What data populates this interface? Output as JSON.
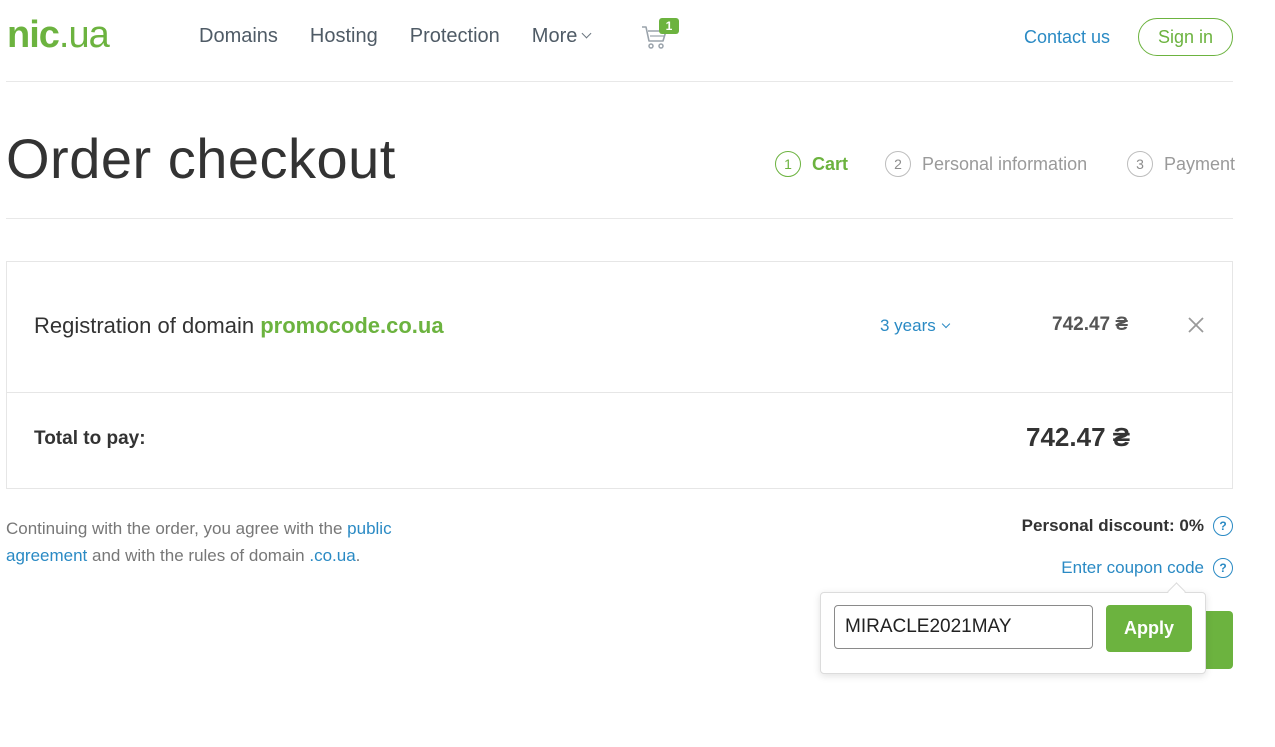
{
  "header": {
    "logo": {
      "part1": "nic",
      "part2": ".ua"
    },
    "nav": [
      "Domains",
      "Hosting",
      "Protection",
      "More"
    ],
    "cart_count": "1",
    "contact_label": "Contact us",
    "signin_label": "Sign in"
  },
  "page": {
    "title": "Order checkout",
    "steps": [
      {
        "num": "1",
        "label": "Cart",
        "active": true
      },
      {
        "num": "2",
        "label": "Personal information",
        "active": false
      },
      {
        "num": "3",
        "label": "Payment",
        "active": false
      }
    ]
  },
  "order": {
    "item_prefix": "Registration of domain ",
    "item_domain": "promocode.co.ua",
    "period": "3 years",
    "item_price": "742.47 ₴",
    "total_label": "Total to pay:",
    "total_value": "742.47 ₴"
  },
  "agreement": {
    "text1": "Continuing with the order, you agree with the ",
    "link1": "public agreement",
    "text2": " and with the rules of domain ",
    "link2": ".co.ua",
    "text3": "."
  },
  "discount": {
    "label": "Personal discount: 0%"
  },
  "coupon": {
    "link_label": "Enter coupon code",
    "input_value": "MIRACLE2021MAY",
    "apply_label": "Apply"
  },
  "colors": {
    "brand_green": "#6cb33f",
    "link_blue": "#2a8ac4",
    "text_dark": "#333333"
  }
}
